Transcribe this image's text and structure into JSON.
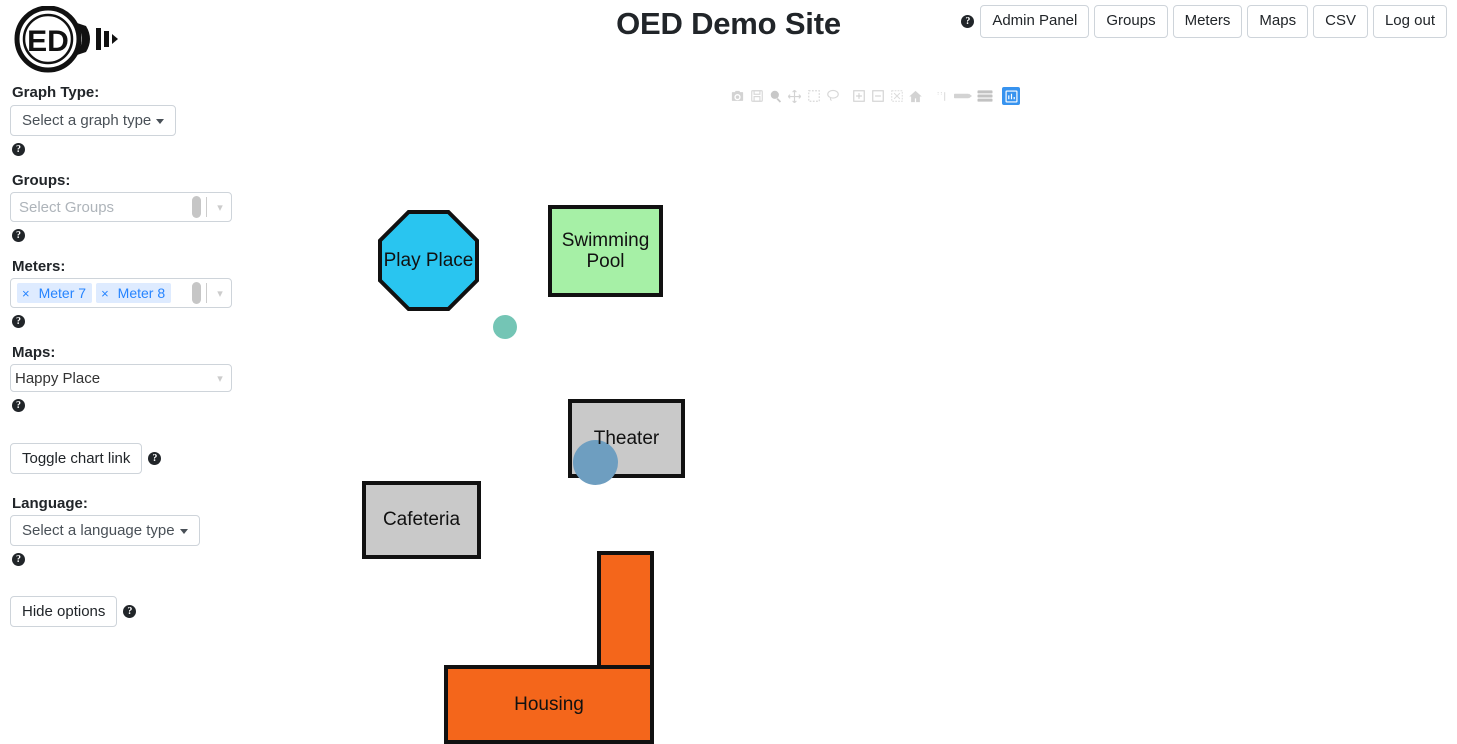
{
  "header": {
    "title": "OED Demo Site",
    "logo_text": "ED",
    "help_icon": "help-circle-icon",
    "nav_buttons": [
      {
        "label": "Admin Panel",
        "name": "admin-panel"
      },
      {
        "label": "Groups",
        "name": "groups"
      },
      {
        "label": "Meters",
        "name": "meters"
      },
      {
        "label": "Maps",
        "name": "maps"
      },
      {
        "label": "CSV",
        "name": "csv"
      },
      {
        "label": "Log out",
        "name": "log-out"
      }
    ]
  },
  "sidebar": {
    "graph_type": {
      "label": "Graph Type:",
      "button_label": "Select a graph type"
    },
    "groups": {
      "label": "Groups:",
      "placeholder": "Select Groups",
      "value": ""
    },
    "meters": {
      "label": "Meters:",
      "placeholder": "",
      "tags": [
        {
          "label": "Meter 7",
          "remove": "×"
        },
        {
          "label": "Meter 8",
          "remove": "×"
        }
      ]
    },
    "maps": {
      "label": "Maps:",
      "selected": "Happy Place"
    },
    "toggle_chart_link": "Toggle chart link",
    "language": {
      "label": "Language:",
      "button_label": "Select a language type"
    },
    "hide_options": "Hide options"
  },
  "modebar": {
    "buttons": [
      {
        "name": "download-camera-icon",
        "title": "Download plot as a png"
      },
      {
        "name": "save-disk-icon",
        "title": "Edit in Chart Studio"
      },
      {
        "name": "zoom-magnifier-icon",
        "title": "Zoom"
      },
      {
        "name": "pan-move-icon",
        "title": "Pan"
      },
      {
        "name": "box-select-icon",
        "title": "Box Select"
      },
      {
        "name": "lasso-select-icon",
        "title": "Lasso Select"
      },
      {
        "name": "zoom-in-icon",
        "title": "Zoom in"
      },
      {
        "name": "zoom-out-icon",
        "title": "Zoom out"
      },
      {
        "name": "autoscale-icon",
        "title": "Autoscale"
      },
      {
        "name": "reset-home-icon",
        "title": "Reset axes"
      },
      {
        "name": "spike-lines-icon",
        "title": "Toggle Spike Lines"
      },
      {
        "name": "hover-compare-icon",
        "title": "Show closest data on hover"
      },
      {
        "name": "hover-x-unified-icon",
        "title": "Compare data on hover"
      },
      {
        "name": "bar-chart-icon",
        "title": "Plotly logo",
        "active": true
      }
    ]
  },
  "map": {
    "name": "Happy Place",
    "colors": {
      "play_place": "#29c5f0",
      "swimming_pool": "#a6f0a6",
      "building_gray": "#c9c9c9",
      "housing_orange": "#f4661b",
      "border": "#111111",
      "marker_teal": "#74c5b5",
      "marker_blue": "#6e9ec0"
    },
    "shapes": [
      {
        "name": "play-place",
        "label": "Play Place",
        "type": "octagon",
        "color": "#29c5f0"
      },
      {
        "name": "swimming-pool",
        "label": "Swimming Pool",
        "type": "rect",
        "color": "#a6f0a6"
      },
      {
        "name": "theater",
        "label": "Theater",
        "type": "rect",
        "color": "#c9c9c9"
      },
      {
        "name": "cafeteria",
        "label": "Cafeteria",
        "type": "rect",
        "color": "#c9c9c9"
      },
      {
        "name": "housing",
        "label": "Housing",
        "type": "l-shape",
        "color": "#f4661b"
      }
    ],
    "markers": [
      {
        "name": "meter-marker-teal",
        "color": "#74c5b5"
      },
      {
        "name": "meter-marker-blue",
        "color": "#6e9ec0"
      }
    ]
  }
}
